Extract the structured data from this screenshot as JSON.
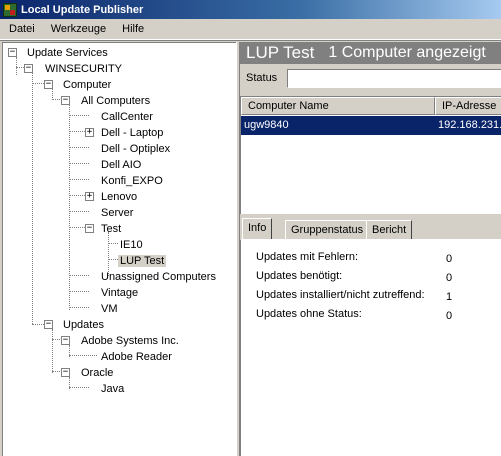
{
  "window": {
    "title": "Local Update Publisher"
  },
  "menu": [
    "Datei",
    "Werkzeuge",
    "Hilfe"
  ],
  "tree": {
    "items": [
      {
        "label": "Update Services",
        "toggle": "−"
      },
      {
        "label": "WINSECURITY",
        "toggle": "−"
      },
      {
        "label": "Computer",
        "toggle": "−"
      },
      {
        "label": "All Computers",
        "toggle": "−"
      },
      {
        "label": "CallCenter",
        "toggle": ""
      },
      {
        "label": "Dell - Laptop",
        "toggle": "+"
      },
      {
        "label": "Dell - Optiplex",
        "toggle": ""
      },
      {
        "label": "Dell AIO",
        "toggle": ""
      },
      {
        "label": "Konfi_EXPO",
        "toggle": ""
      },
      {
        "label": "Lenovo",
        "toggle": "+"
      },
      {
        "label": "Server",
        "toggle": ""
      },
      {
        "label": "Test",
        "toggle": "−"
      },
      {
        "label": "IE10",
        "toggle": ""
      },
      {
        "label": "LUP Test",
        "toggle": ""
      },
      {
        "label": "Unassigned Computers",
        "toggle": ""
      },
      {
        "label": "Vintage",
        "toggle": ""
      },
      {
        "label": "VM",
        "toggle": ""
      },
      {
        "label": "Updates",
        "toggle": "−"
      },
      {
        "label": "Adobe Systems Inc.",
        "toggle": "−"
      },
      {
        "label": "Adobe Reader",
        "toggle": ""
      },
      {
        "label": "Oracle",
        "toggle": "−"
      },
      {
        "label": "Java",
        "toggle": ""
      }
    ]
  },
  "header": {
    "title": "LUP Test",
    "count": "1 Computer angezeigt"
  },
  "status": {
    "label": "Status",
    "value": ""
  },
  "grid": {
    "columns": [
      "Computer Name",
      "IP-Adresse"
    ],
    "rows": [
      {
        "name": "ugw9840",
        "ip": "192.168.231."
      }
    ]
  },
  "tabs": [
    "Info",
    "Gruppenstatus",
    "Bericht"
  ],
  "info": [
    {
      "label": "Updates mit Fehlern:",
      "value": "0"
    },
    {
      "label": "Updates benötigt:",
      "value": "0"
    },
    {
      "label": "Updates installiert/nicht zutreffend:",
      "value": "1"
    },
    {
      "label": "Updates ohne Status:",
      "value": "0"
    }
  ]
}
